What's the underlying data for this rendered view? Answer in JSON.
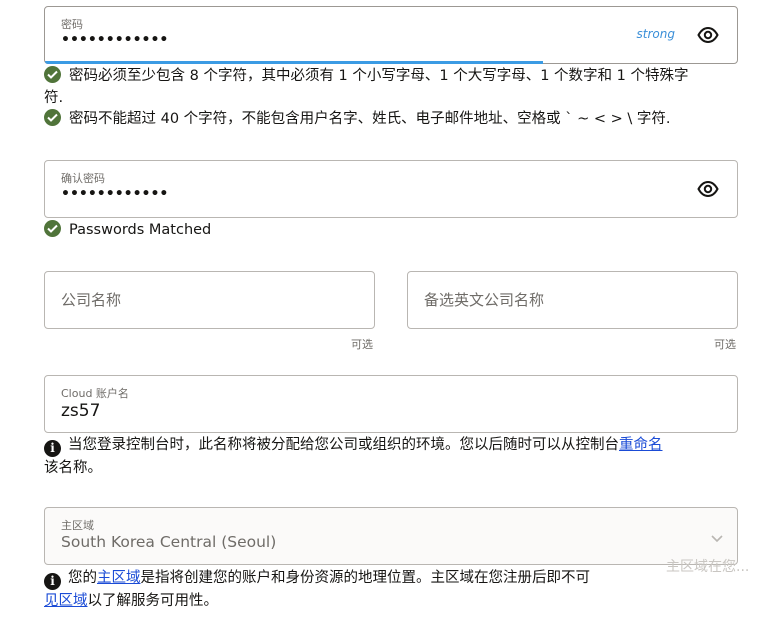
{
  "password": {
    "label": "密码",
    "value": "••••••••••••",
    "strength": "strong",
    "strength_fraction": 0.72
  },
  "password_rules": [
    {
      "line1": "密码必须至少包含 8 个字符，其中必须有 1 个小写字母、1 个大写字母、1 个数字和 1 个特殊字",
      "line2": "符."
    },
    {
      "line1": "密码不能超过 40 个字符，不能包含用户名字、姓氏、电子邮件地址、空格或 ` ~ < > \\ 字符."
    }
  ],
  "confirm_password": {
    "label": "确认密码",
    "value": "••••••••••••",
    "match_message": "Passwords Matched"
  },
  "company_name": {
    "placeholder": "公司名称",
    "optional": "可选"
  },
  "alt_company_name": {
    "placeholder": "备选英文公司名称",
    "optional": "可选"
  },
  "cloud_account": {
    "label": "Cloud 账户名",
    "value": "zs57",
    "info_before": "当您登录控制台时，此名称将被分配给您公司或组织的环境。您以后随时可以从控制台",
    "info_link": "重命名",
    "info_after": "该名称。"
  },
  "home_region": {
    "label": "主区域",
    "value": "South Korea Central (Seoul)",
    "info_prefix": "您的",
    "info_link1": "主区域",
    "info_middle": "是指将创建您的账户和身份资源的地理位置。主区域在您注册后即不可",
    "info_link2": "见区域",
    "info_after": "以了解服务可用性。",
    "overlay": "主区域在您..."
  },
  "colors": {
    "check_green": "#50743a",
    "strength_blue": "#3b9be4",
    "link_blue": "#1a4bd6"
  },
  "icons": {
    "eye": "eye-icon",
    "check": "check-circle-icon",
    "info": "info-icon",
    "chevron": "chevron-down-icon"
  }
}
